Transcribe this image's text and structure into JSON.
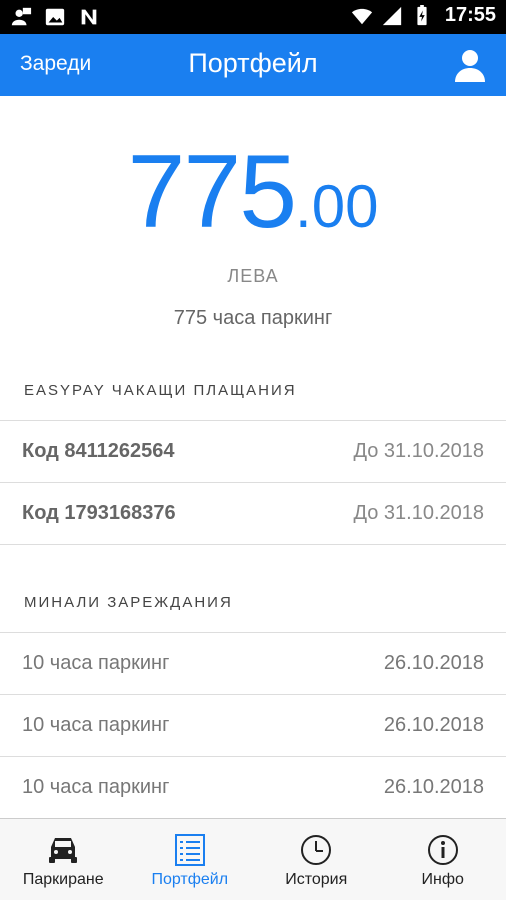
{
  "status_bar": {
    "time": "17:55",
    "left_icons": [
      "account-notification-icon",
      "image-icon",
      "n-notification-icon"
    ],
    "right_icons": [
      "wifi-icon",
      "signal-icon",
      "battery-icon"
    ]
  },
  "app_bar": {
    "recharge_label": "Зареди",
    "title": "Портфейл",
    "profile_icon": "person-icon"
  },
  "balance": {
    "amount_int": "775",
    "amount_dec": ".00",
    "currency": "ЛЕВА",
    "hours": "775 часа паркинг"
  },
  "easypay": {
    "header": "EASYPAY ЧАКАЩИ ПЛАЩАНИЯ",
    "rows": [
      {
        "code": "Код 8411262564",
        "due": "До 31.10.2018"
      },
      {
        "code": "Код 1793168376",
        "due": "До 31.10.2018"
      }
    ]
  },
  "past_recharges": {
    "header": "МИНАЛИ ЗАРЕЖДАНИЯ",
    "rows": [
      {
        "label": "10 часа паркинг",
        "date": "26.10.2018"
      },
      {
        "label": "10 часа паркинг",
        "date": "26.10.2018"
      },
      {
        "label": "10 часа паркинг",
        "date": "26.10.2018"
      }
    ]
  },
  "bottom_nav": {
    "items": [
      {
        "label": "Паркиране",
        "icon": "car-icon"
      },
      {
        "label": "Портфейл",
        "icon": "list-icon",
        "active": true
      },
      {
        "label": "История",
        "icon": "clock-icon"
      },
      {
        "label": "Инфо",
        "icon": "info-icon"
      }
    ]
  },
  "colors": {
    "accent": "#1a7ff0",
    "status_bar": "#000000"
  }
}
